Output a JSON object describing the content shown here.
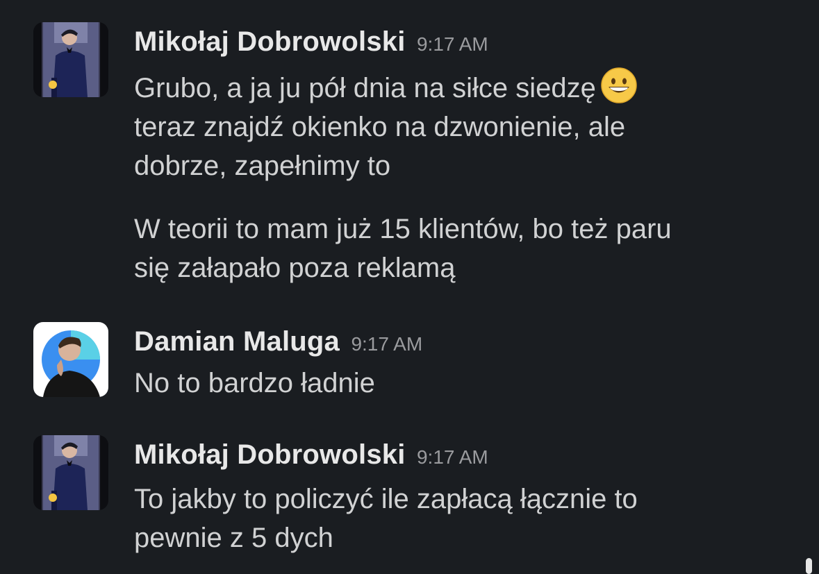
{
  "messages": [
    {
      "author": "Mikołaj Dobrowolski",
      "time": "9:17 AM",
      "avatar_icon": "user-photo-suit",
      "paragraphs": [
        {
          "line1": "Grubo, a ja ju pół dnia na siłce siedzę",
          "emoji": "grinning-face",
          "line2": "teraz znajdź okienko na dzwonienie, ale",
          "line3": "dobrze, zapełnimy to"
        },
        {
          "line1": "W teorii to mam już 15 klientów, bo też paru",
          "line2": "się załapało poza reklamą"
        }
      ]
    },
    {
      "author": "Damian Maluga",
      "time": "9:17 AM",
      "avatar_icon": "user-photo-blue-circle",
      "paragraphs": [
        {
          "line1": "No to bardzo ładnie"
        }
      ]
    },
    {
      "author": "Mikołaj Dobrowolski",
      "time": "9:17 AM",
      "avatar_icon": "user-photo-suit",
      "paragraphs": [
        {
          "line1": "To jakby to policzyć ile zapłacą łącznie to",
          "line2": "pewnie z 5 dych"
        }
      ]
    }
  ],
  "colors": {
    "background": "#1a1d21",
    "author": "#e8e8e8",
    "timestamp": "#9a9b9e",
    "message_text": "#d1d2d3"
  }
}
